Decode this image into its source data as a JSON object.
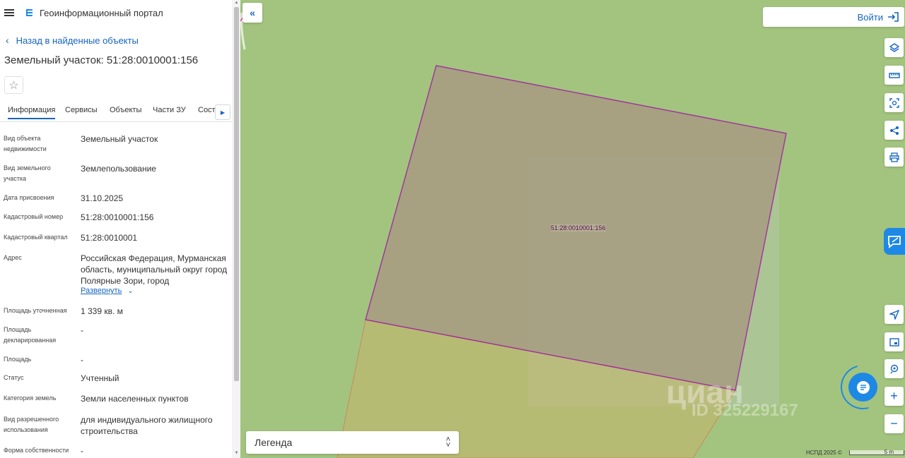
{
  "header": {
    "app_title": "Геоинформационный портал"
  },
  "nav": {
    "back_label": "Назад в найденные объекты"
  },
  "object": {
    "title": "Земельный участок: 51:28:0010001:156"
  },
  "tabs": [
    "Информация",
    "Сервисы",
    "Объекты",
    "Части ЗУ",
    "Состав"
  ],
  "fields": [
    {
      "label": "Вид объекта недвижимости",
      "value": "Земельный участок"
    },
    {
      "label": "Вид земельного участка",
      "value": "Землепользование"
    },
    {
      "label": "Дата присвоения",
      "value": "31.10.2025"
    },
    {
      "label": "Кадастровый номер",
      "value": "51:28:0010001:156"
    },
    {
      "label": "Кадастровый квартал",
      "value": "51:28:0010001"
    },
    {
      "label": "Адрес",
      "value": "Российская Федерация, Мурманская область, муниципальный округ город Полярные Зори, город"
    },
    {
      "label": "Площадь уточненная",
      "value": "1 339 кв. м"
    },
    {
      "label": "Площадь декларированная",
      "value": "-"
    },
    {
      "label": "Площадь",
      "value": "-"
    },
    {
      "label": "Статус",
      "value": "Учтенный"
    },
    {
      "label": "Категория земель",
      "value": "Земли населенных пунктов"
    },
    {
      "label": "Вид разрешенного использования",
      "value": "для индивидуального жилищного строительства"
    },
    {
      "label": "Форма собственности",
      "value": "-"
    }
  ],
  "expand_label": "Развернуть",
  "map": {
    "parcel_label": "51:28:0010001:156",
    "login_label": "Войти",
    "legend_label": "Легенда",
    "copyright": "НСПД 2025 ©",
    "scale_label": "5 m",
    "watermark": "циан",
    "watermark_id": "ID 325229167",
    "colors": {
      "map_bg": "#a3c47f",
      "parcel_fill": "#a89c82",
      "parcel_stroke": "#a020a0",
      "accent": "#1565c0"
    }
  },
  "icons": [
    "menu-icon",
    "logo-icon",
    "chevron-left-icon",
    "star-icon",
    "chevron-right-icon",
    "double-chevron-left-icon",
    "login-icon",
    "layers-icon",
    "ruler-icon",
    "area-select-icon",
    "share-icon",
    "print-icon",
    "chat-icon",
    "locate-icon",
    "minimap-icon",
    "location-search-icon",
    "zoom-in-icon",
    "zoom-out-icon",
    "sort-icon"
  ]
}
